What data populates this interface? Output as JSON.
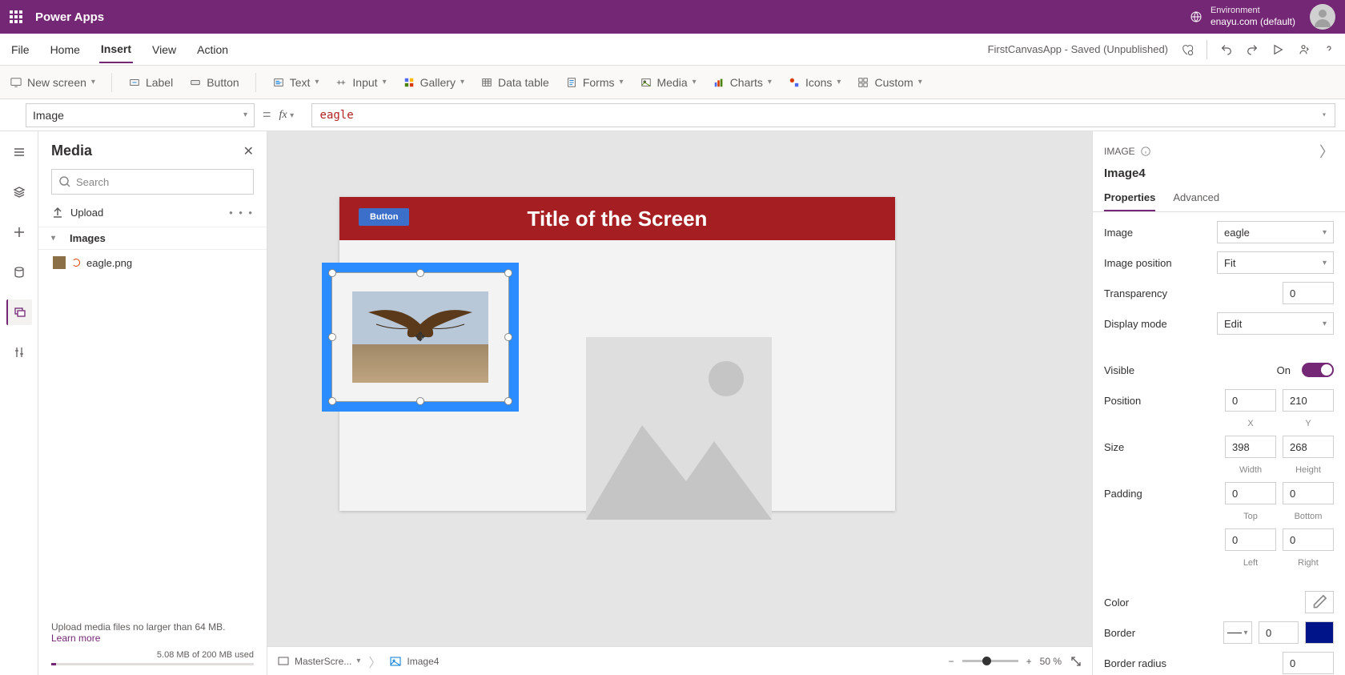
{
  "header": {
    "appName": "Power Apps",
    "envLabel": "Environment",
    "envValue": "enayu.com (default)"
  },
  "menubar": {
    "items": [
      "File",
      "Home",
      "Insert",
      "View",
      "Action"
    ],
    "activeIndex": 2,
    "appStatus": "FirstCanvasApp - Saved (Unpublished)"
  },
  "toolbar": {
    "newScreen": "New screen",
    "label": "Label",
    "button": "Button",
    "text": "Text",
    "input": "Input",
    "gallery": "Gallery",
    "dataTable": "Data table",
    "forms": "Forms",
    "media": "Media",
    "charts": "Charts",
    "icons": "Icons",
    "custom": "Custom"
  },
  "formulabar": {
    "property": "Image",
    "formula": "eagle"
  },
  "mediaPanel": {
    "title": "Media",
    "searchPlaceholder": "Search",
    "upload": "Upload",
    "sectionImages": "Images",
    "file1": "eagle.png",
    "footerText": "Upload media files no larger than 64 MB.",
    "learnMore": "Learn more",
    "usedText": "5.08 MB of 200 MB used"
  },
  "canvas": {
    "screenTitle": "Title of the Screen",
    "buttonLabel": "Button",
    "breadcrumb1": "MasterScre...",
    "breadcrumb2": "Image4",
    "zoomPercent": "50 %"
  },
  "props": {
    "typeLabel": "IMAGE",
    "name": "Image4",
    "tabProps": "Properties",
    "tabAdv": "Advanced",
    "image": {
      "label": "Image",
      "value": "eagle"
    },
    "imagePos": {
      "label": "Image position",
      "value": "Fit"
    },
    "transparency": {
      "label": "Transparency",
      "value": "0"
    },
    "displayMode": {
      "label": "Display mode",
      "value": "Edit"
    },
    "visible": {
      "label": "Visible",
      "state": "On"
    },
    "position": {
      "label": "Position",
      "x": "0",
      "y": "210",
      "xLabel": "X",
      "yLabel": "Y"
    },
    "size": {
      "label": "Size",
      "w": "398",
      "h": "268",
      "wLabel": "Width",
      "hLabel": "Height"
    },
    "padding": {
      "label": "Padding",
      "t": "0",
      "r": "0",
      "b": "0",
      "l": "0",
      "tLabel": "Top",
      "bLabel": "Bottom",
      "lLabel": "Left",
      "rLabel": "Right"
    },
    "color": {
      "label": "Color"
    },
    "border": {
      "label": "Border",
      "value": "0"
    },
    "borderRadius": {
      "label": "Border radius",
      "value": "0"
    }
  }
}
